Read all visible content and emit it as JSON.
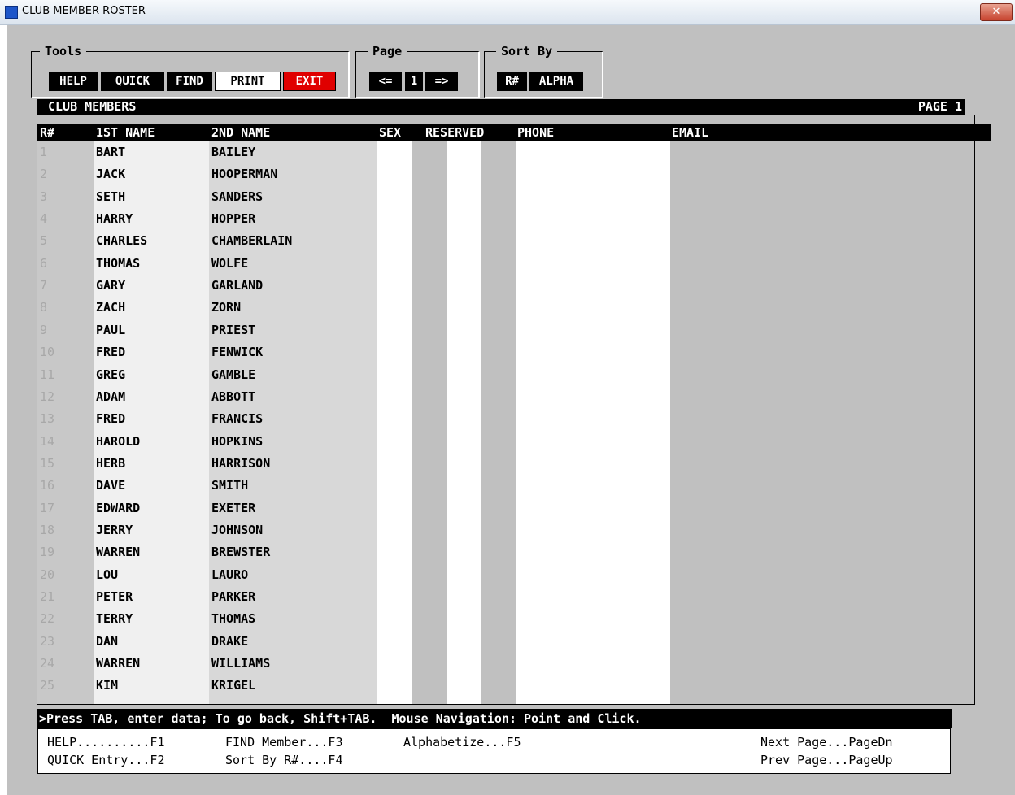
{
  "window": {
    "title": "CLUB MEMBER ROSTER",
    "close_glyph": "✕"
  },
  "tools": {
    "label": "Tools",
    "buttons": [
      "HELP",
      "QUICK",
      "FIND",
      "PRINT",
      "EXIT"
    ]
  },
  "page_nav": {
    "label": "Page",
    "prev": "<=",
    "current": "1",
    "next": "=>"
  },
  "sort_by": {
    "label": "Sort By",
    "buttons": [
      "R#",
      "ALPHA"
    ]
  },
  "header": {
    "left": "CLUB MEMBERS",
    "right": "PAGE 1"
  },
  "columns": [
    "R#",
    "1ST NAME",
    "2ND NAME",
    "SEX",
    "RESERVED",
    "PHONE",
    "EMAIL"
  ],
  "rows": [
    {
      "n": "1",
      "first": "BART",
      "last": "BAILEY"
    },
    {
      "n": "2",
      "first": "JACK",
      "last": "HOOPERMAN"
    },
    {
      "n": "3",
      "first": "SETH",
      "last": "SANDERS"
    },
    {
      "n": "4",
      "first": "HARRY",
      "last": "HOPPER"
    },
    {
      "n": "5",
      "first": "CHARLES",
      "last": "CHAMBERLAIN"
    },
    {
      "n": "6",
      "first": "THOMAS",
      "last": "WOLFE"
    },
    {
      "n": "7",
      "first": "GARY",
      "last": "GARLAND"
    },
    {
      "n": "8",
      "first": "ZACH",
      "last": "ZORN"
    },
    {
      "n": "9",
      "first": "PAUL",
      "last": "PRIEST"
    },
    {
      "n": "10",
      "first": "FRED",
      "last": "FENWICK"
    },
    {
      "n": "11",
      "first": "GREG",
      "last": "GAMBLE"
    },
    {
      "n": "12",
      "first": "ADAM",
      "last": "ABBOTT"
    },
    {
      "n": "13",
      "first": "FRED",
      "last": "FRANCIS"
    },
    {
      "n": "14",
      "first": "HAROLD",
      "last": "HOPKINS"
    },
    {
      "n": "15",
      "first": "HERB",
      "last": "HARRISON"
    },
    {
      "n": "16",
      "first": "DAVE",
      "last": "SMITH"
    },
    {
      "n": "17",
      "first": "EDWARD",
      "last": "EXETER"
    },
    {
      "n": "18",
      "first": "JERRY",
      "last": "JOHNSON"
    },
    {
      "n": "19",
      "first": "WARREN",
      "last": "BREWSTER"
    },
    {
      "n": "20",
      "first": "LOU",
      "last": "LAURO"
    },
    {
      "n": "21",
      "first": "PETER",
      "last": "PARKER"
    },
    {
      "n": "22",
      "first": "TERRY",
      "last": "THOMAS"
    },
    {
      "n": "23",
      "first": "DAN",
      "last": "DRAKE"
    },
    {
      "n": "24",
      "first": "WARREN",
      "last": "WILLIAMS"
    },
    {
      "n": "25",
      "first": "KIM",
      "last": "KRIGEL"
    }
  ],
  "status": ">Press TAB, enter data; To go back, Shift+TAB.  Mouse Navigation: Point and Click.",
  "fkeys": [
    [
      "HELP..........F1",
      "QUICK Entry...F2"
    ],
    [
      "FIND Member...F3",
      "Sort By R#....F4"
    ],
    [
      "Alphabetize...F5",
      ""
    ],
    [
      "",
      ""
    ],
    [
      "Next Page...PageDn",
      "Prev Page...PageUp"
    ]
  ],
  "colors": {
    "exit": "#e00000",
    "background": "#c0c0c0"
  }
}
